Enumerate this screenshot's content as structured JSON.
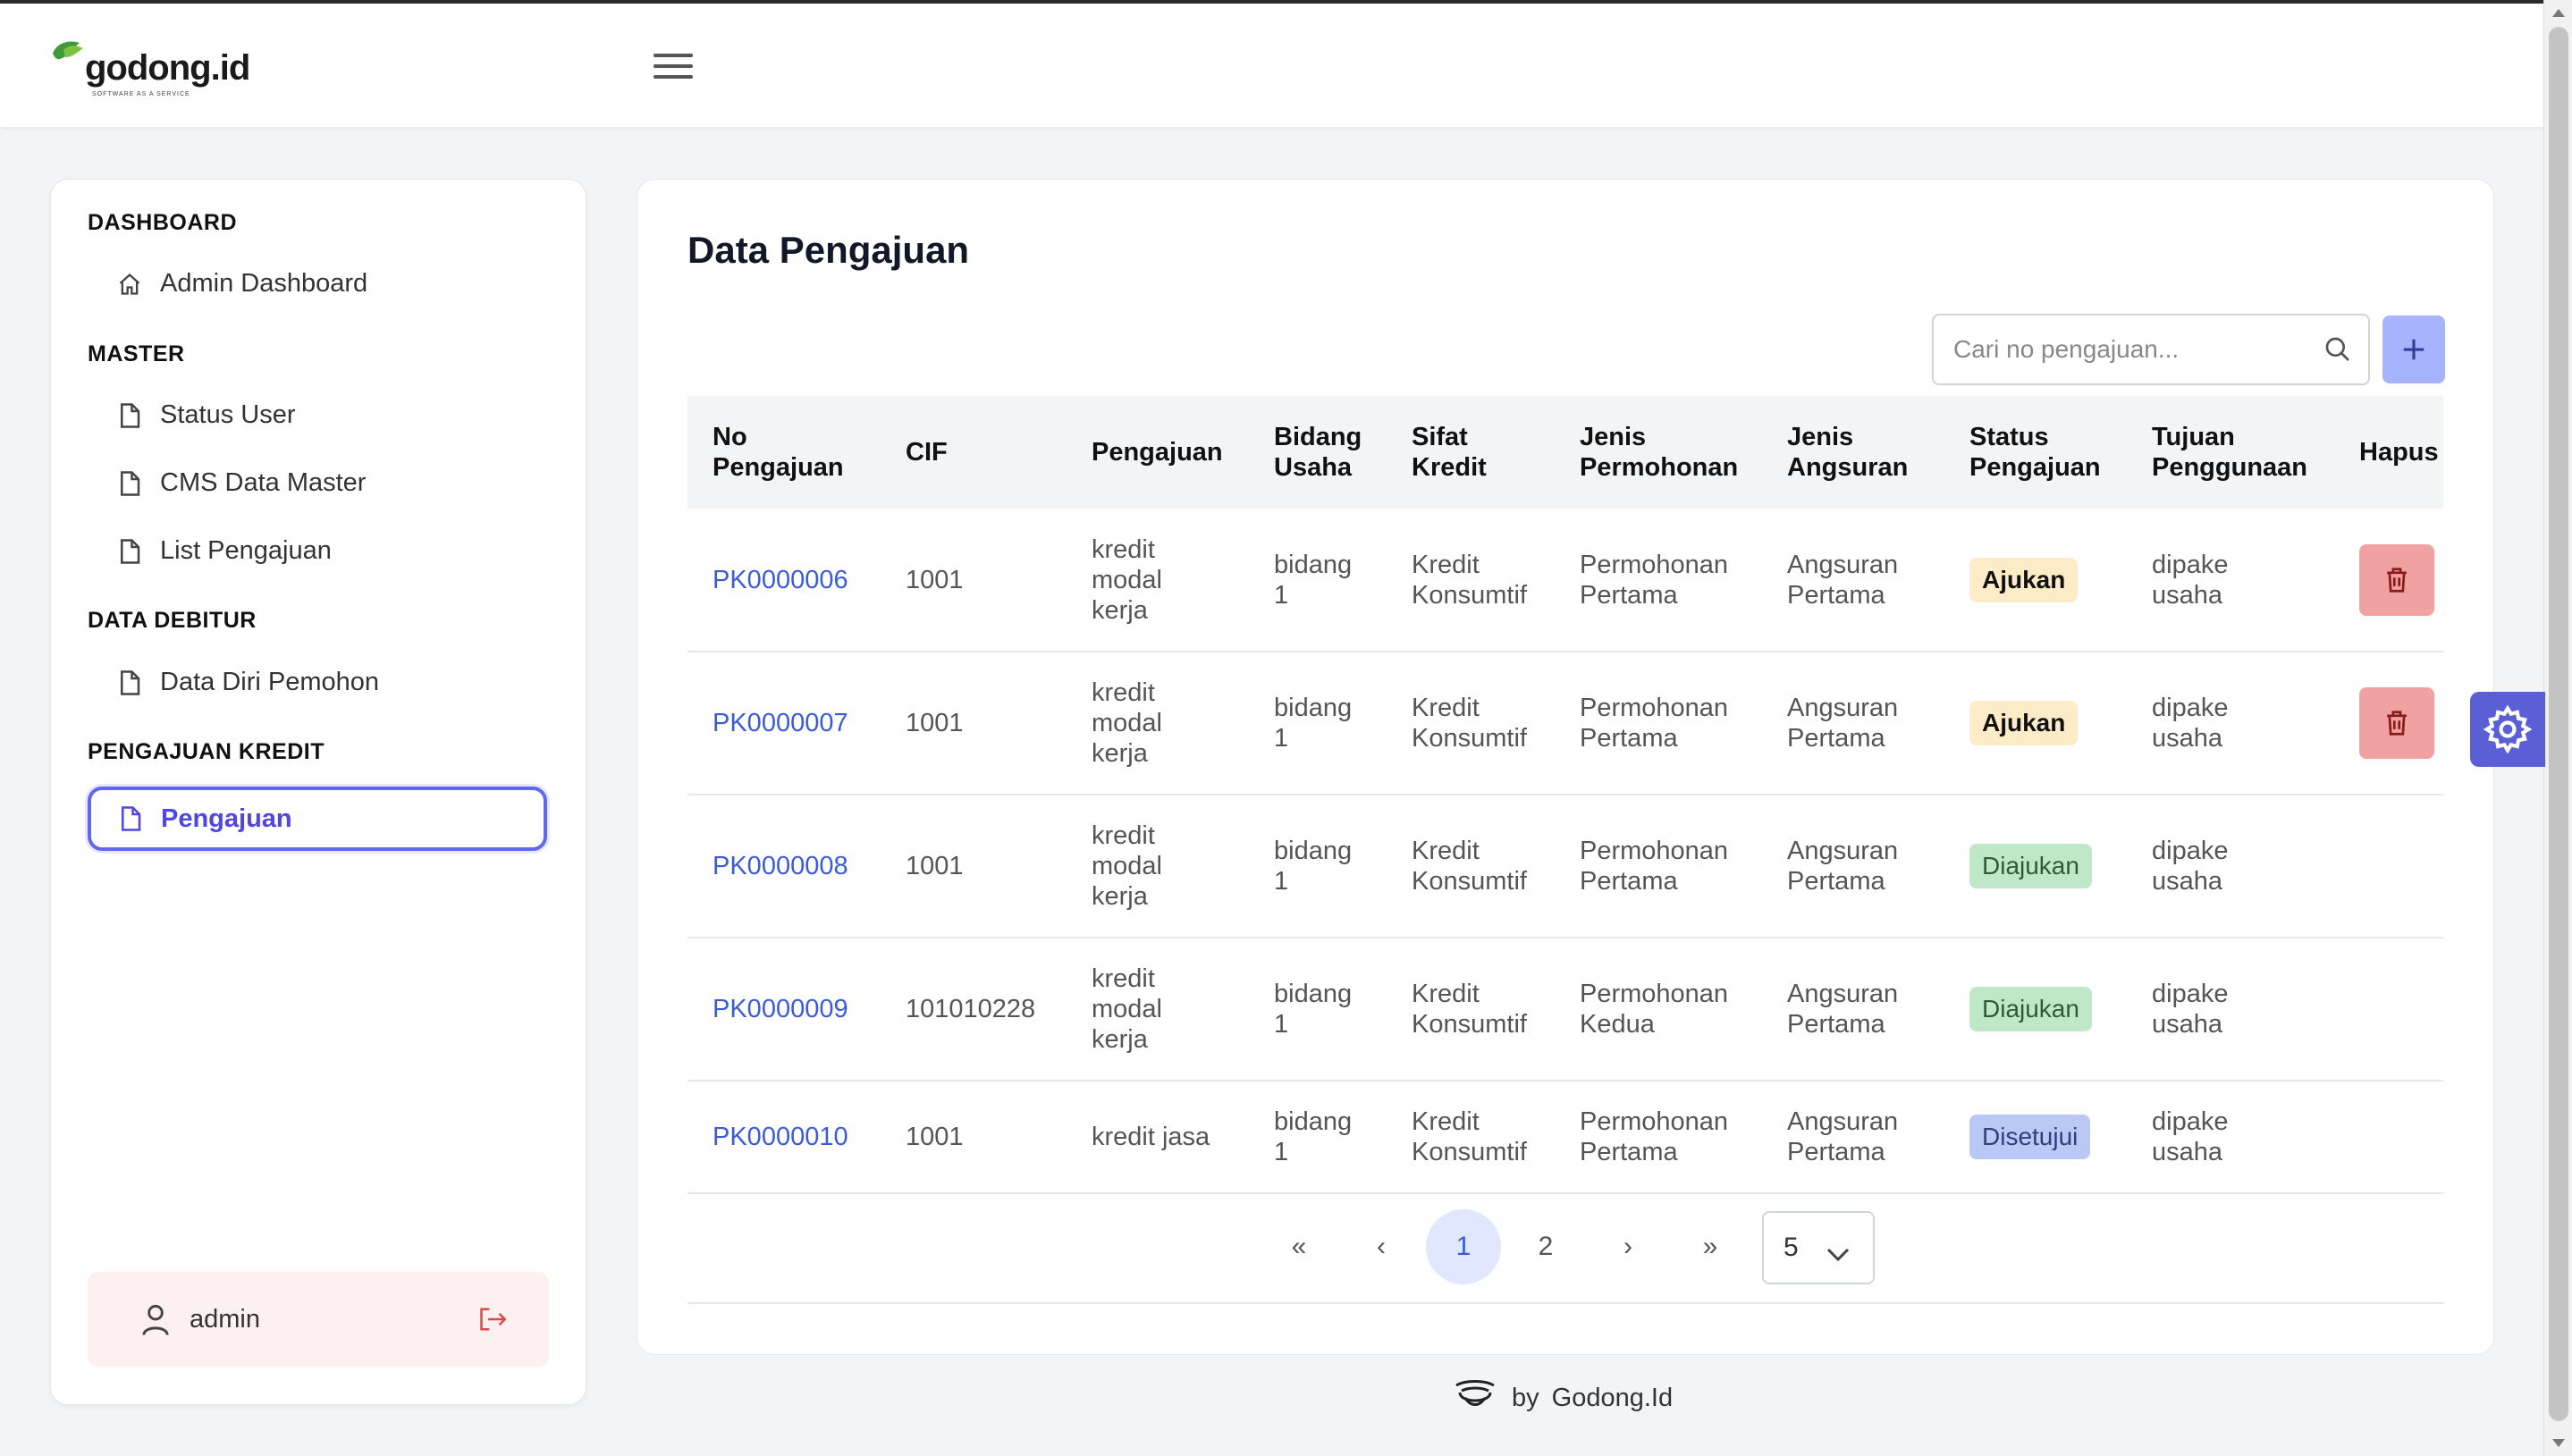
{
  "app": {
    "logo_text": "godong.id",
    "logo_tagline": "SOFTWARE AS A SERVICE"
  },
  "sidebar": {
    "sections": [
      {
        "title": "DASHBOARD",
        "items": [
          {
            "label": "Admin Dashboard",
            "icon": "home-icon"
          }
        ]
      },
      {
        "title": "MASTER",
        "items": [
          {
            "label": "Status User",
            "icon": "file-icon"
          },
          {
            "label": "CMS Data Master",
            "icon": "file-icon"
          },
          {
            "label": "List Pengajuan",
            "icon": "file-icon"
          }
        ]
      },
      {
        "title": "DATA DEBITUR",
        "items": [
          {
            "label": "Data Diri Pemohon",
            "icon": "file-icon"
          }
        ]
      },
      {
        "title": "PENGAJUAN KREDIT",
        "items": [
          {
            "label": "Pengajuan",
            "icon": "file-icon",
            "active": true
          }
        ]
      }
    ],
    "user": {
      "name": "admin"
    }
  },
  "main": {
    "title": "Data Pengajuan",
    "search": {
      "placeholder": "Cari no pengajuan...",
      "value": ""
    },
    "table": {
      "headers": {
        "no": [
          "No",
          "Pengajuan"
        ],
        "cif": [
          "CIF"
        ],
        "pengajuan": [
          "Pengajuan"
        ],
        "bidang": [
          "Bidang",
          "Usaha"
        ],
        "sifat": [
          "Sifat",
          "Kredit"
        ],
        "jenis_permohonan": [
          "Jenis",
          "Permohonan"
        ],
        "jenis_angsuran": [
          "Jenis",
          "Angsuran"
        ],
        "status": [
          "Status",
          "Pengajuan"
        ],
        "tujuan": [
          "Tujuan",
          "Penggunaan"
        ],
        "hapus": [
          "Hapus"
        ]
      },
      "rows": [
        {
          "no": "PK0000006",
          "cif": "1001",
          "pengajuan": [
            "kredit",
            "modal",
            "kerja"
          ],
          "bidang": [
            "bidang",
            "1"
          ],
          "sifat": [
            "Kredit",
            "Konsumtif"
          ],
          "permohonan": [
            "Permohonan",
            "Pertama"
          ],
          "angsuran": [
            "Angsuran",
            "Pertama"
          ],
          "status": "Ajukan",
          "tujuan": [
            "dipake",
            "usaha"
          ],
          "deletable": true
        },
        {
          "no": "PK0000007",
          "cif": "1001",
          "pengajuan": [
            "kredit",
            "modal",
            "kerja"
          ],
          "bidang": [
            "bidang",
            "1"
          ],
          "sifat": [
            "Kredit",
            "Konsumtif"
          ],
          "permohonan": [
            "Permohonan",
            "Pertama"
          ],
          "angsuran": [
            "Angsuran",
            "Pertama"
          ],
          "status": "Ajukan",
          "tujuan": [
            "dipake",
            "usaha"
          ],
          "deletable": true
        },
        {
          "no": "PK0000008",
          "cif": "1001",
          "pengajuan": [
            "kredit",
            "modal",
            "kerja"
          ],
          "bidang": [
            "bidang",
            "1"
          ],
          "sifat": [
            "Kredit",
            "Konsumtif"
          ],
          "permohonan": [
            "Permohonan",
            "Pertama"
          ],
          "angsuran": [
            "Angsuran",
            "Pertama"
          ],
          "status": "Diajukan",
          "tujuan": [
            "dipake",
            "usaha"
          ],
          "deletable": false
        },
        {
          "no": "PK0000009",
          "cif": "101010228",
          "pengajuan": [
            "kredit",
            "modal",
            "kerja"
          ],
          "bidang": [
            "bidang",
            "1"
          ],
          "sifat": [
            "Kredit",
            "Konsumtif"
          ],
          "permohonan": [
            "Permohonan",
            "Kedua"
          ],
          "angsuran": [
            "Angsuran",
            "Pertama"
          ],
          "status": "Diajukan",
          "tujuan": [
            "dipake",
            "usaha"
          ],
          "deletable": false
        },
        {
          "no": "PK0000010",
          "cif": "1001",
          "pengajuan": [
            "kredit jasa"
          ],
          "bidang": [
            "bidang",
            "1"
          ],
          "sifat": [
            "Kredit",
            "Konsumtif"
          ],
          "permohonan": [
            "Permohonan",
            "Pertama"
          ],
          "angsuran": [
            "Angsuran",
            "Pertama"
          ],
          "status": "Disetujui",
          "tujuan": [
            "dipake",
            "usaha"
          ],
          "deletable": false
        }
      ]
    },
    "pagination": {
      "first": "«",
      "prev": "‹",
      "pages": [
        "1",
        "2"
      ],
      "current": "1",
      "next": "›",
      "last": "»",
      "per_page": "5"
    }
  },
  "footer": {
    "by": "by",
    "brand": "Godong.Id"
  },
  "colors": {
    "accent": "#6366f1",
    "link": "#3b5bdb",
    "add_button": "#a5b4fc",
    "delete_button": "#f0a2a2",
    "status_ajukan": "#fdecc8",
    "status_diajukan": "#bfe8c8",
    "status_disetujui": "#b9c8f5"
  }
}
